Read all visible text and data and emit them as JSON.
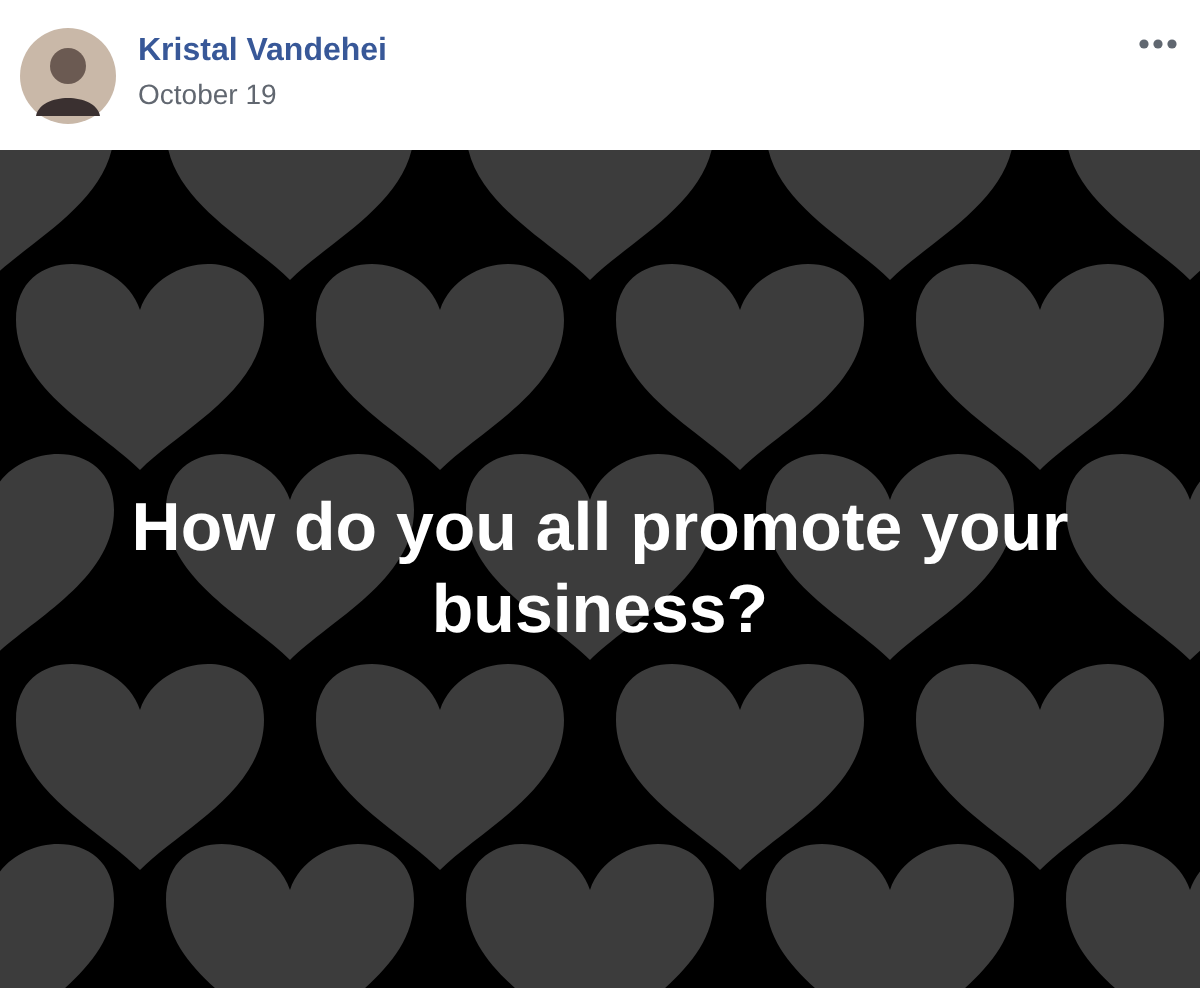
{
  "post": {
    "author": "Kristal Vandehei",
    "date": "October 19",
    "text": "How do you all promote your business?"
  }
}
